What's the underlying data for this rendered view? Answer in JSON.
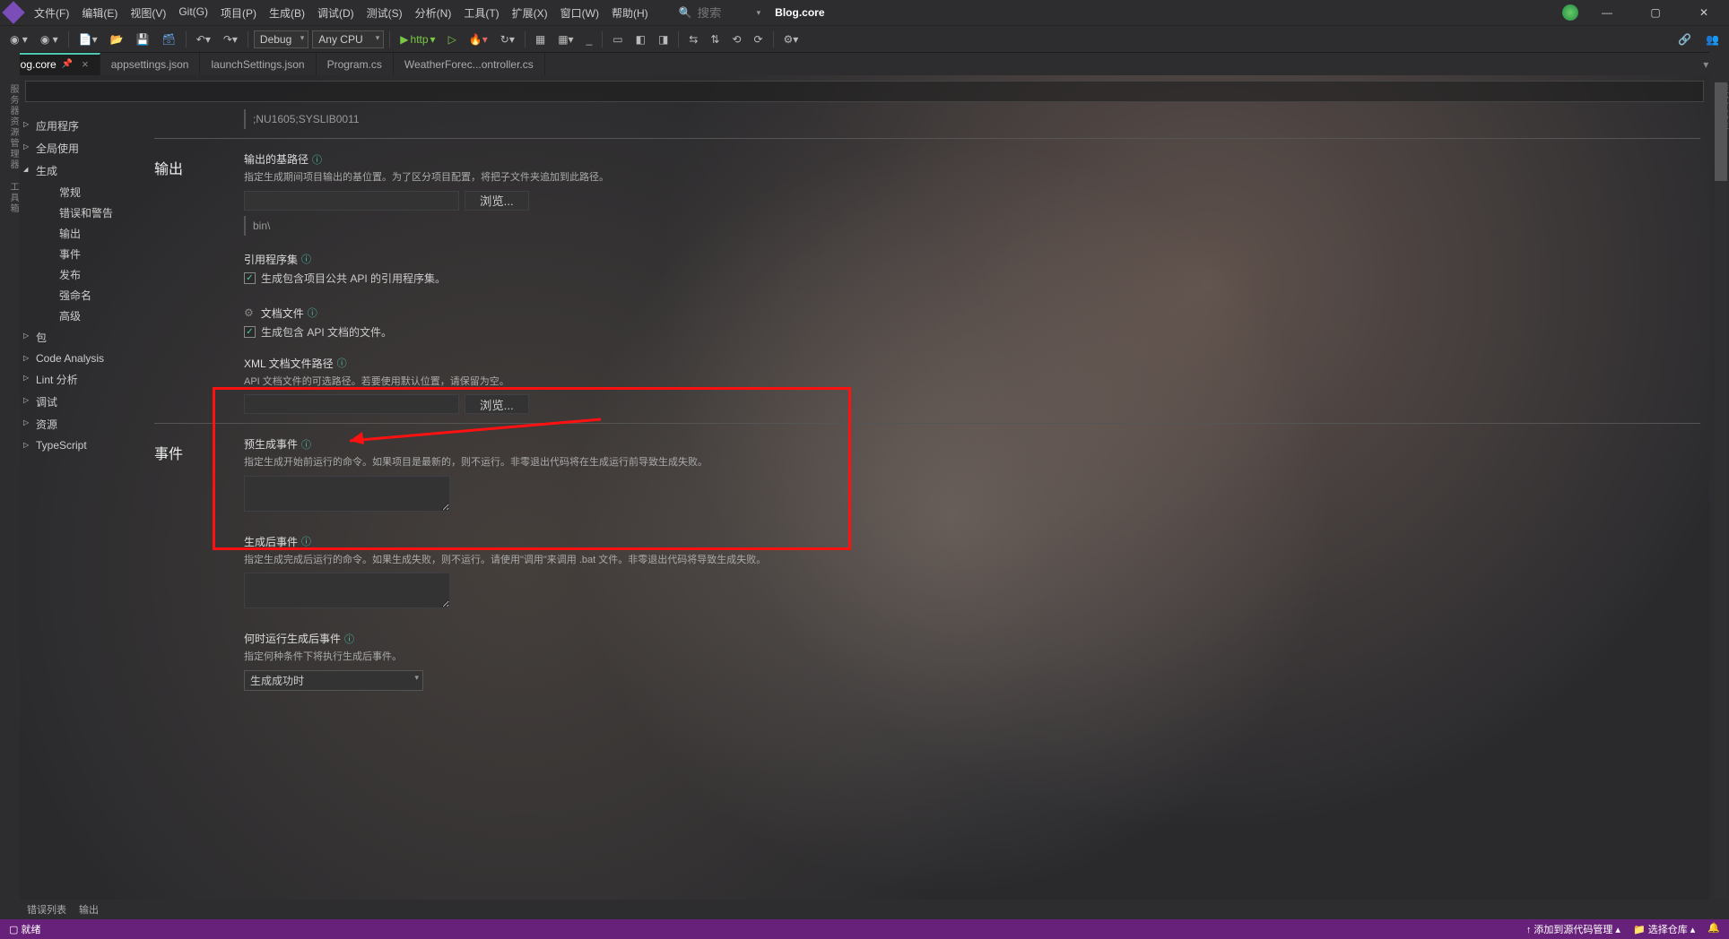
{
  "menus": [
    "文件(F)",
    "编辑(E)",
    "视图(V)",
    "Git(G)",
    "项目(P)",
    "生成(B)",
    "调试(D)",
    "测试(S)",
    "分析(N)",
    "工具(T)",
    "扩展(X)",
    "窗口(W)",
    "帮助(H)"
  ],
  "search_placeholder": "搜索",
  "solution": "Blog.core",
  "config": "Debug",
  "platform": "Any CPU",
  "launch": "http",
  "tabs": [
    "Blog.core",
    "appsettings.json",
    "launchSettings.json",
    "Program.cs",
    "WeatherForec...ontroller.cs"
  ],
  "side": {
    "app": "应用程序",
    "global": "全局使用",
    "build": "生成",
    "build_children": [
      "常规",
      "错误和警告",
      "输出",
      "事件",
      "发布",
      "强命名",
      "高级"
    ],
    "build_selected": "输出",
    "pkg": "包",
    "code": "Code Analysis",
    "lint": "Lint 分析",
    "debug": "调试",
    "res": "资源",
    "ts": "TypeScript"
  },
  "content": {
    "nowarn": ";NU1605;SYSLIB0011",
    "output_hdr": "输出",
    "base_path_lbl": "输出的基路径",
    "base_path_desc": "指定生成期间项目输出的基位置。为了区分项目配置，将把子文件夹追加到此路径。",
    "browse": "浏览...",
    "bin": "bin\\",
    "ref_lbl": "引用程序集",
    "ref_chk": "生成包含项目公共 API 的引用程序集。",
    "doc_lbl": "文档文件",
    "doc_chk": "生成包含 API 文档的文件。",
    "xml_lbl": "XML 文档文件路径",
    "xml_desc": "API 文档文件的可选路径。若要使用默认位置，请保留为空。",
    "events_hdr": "事件",
    "pre_lbl": "预生成事件",
    "pre_desc": "指定生成开始前运行的命令。如果项目是最新的，则不运行。非零退出代码将在生成运行前导致生成失败。",
    "post_lbl": "生成后事件",
    "post_desc": "指定生成完成后运行的命令。如果生成失败，则不运行。请使用\"调用\"来调用 .bat 文件。非零退出代码将导致生成失败。",
    "when_lbl": "何时运行生成后事件",
    "when_desc": "指定何种条件下将执行生成后事件。",
    "when_val": "生成成功时"
  },
  "bottom": {
    "errlist": "错误列表",
    "output": "输出"
  },
  "status": {
    "ready": "就绪",
    "scm": "添加到源代码管理",
    "repo": "选择仓库",
    "bell": "🔔"
  }
}
